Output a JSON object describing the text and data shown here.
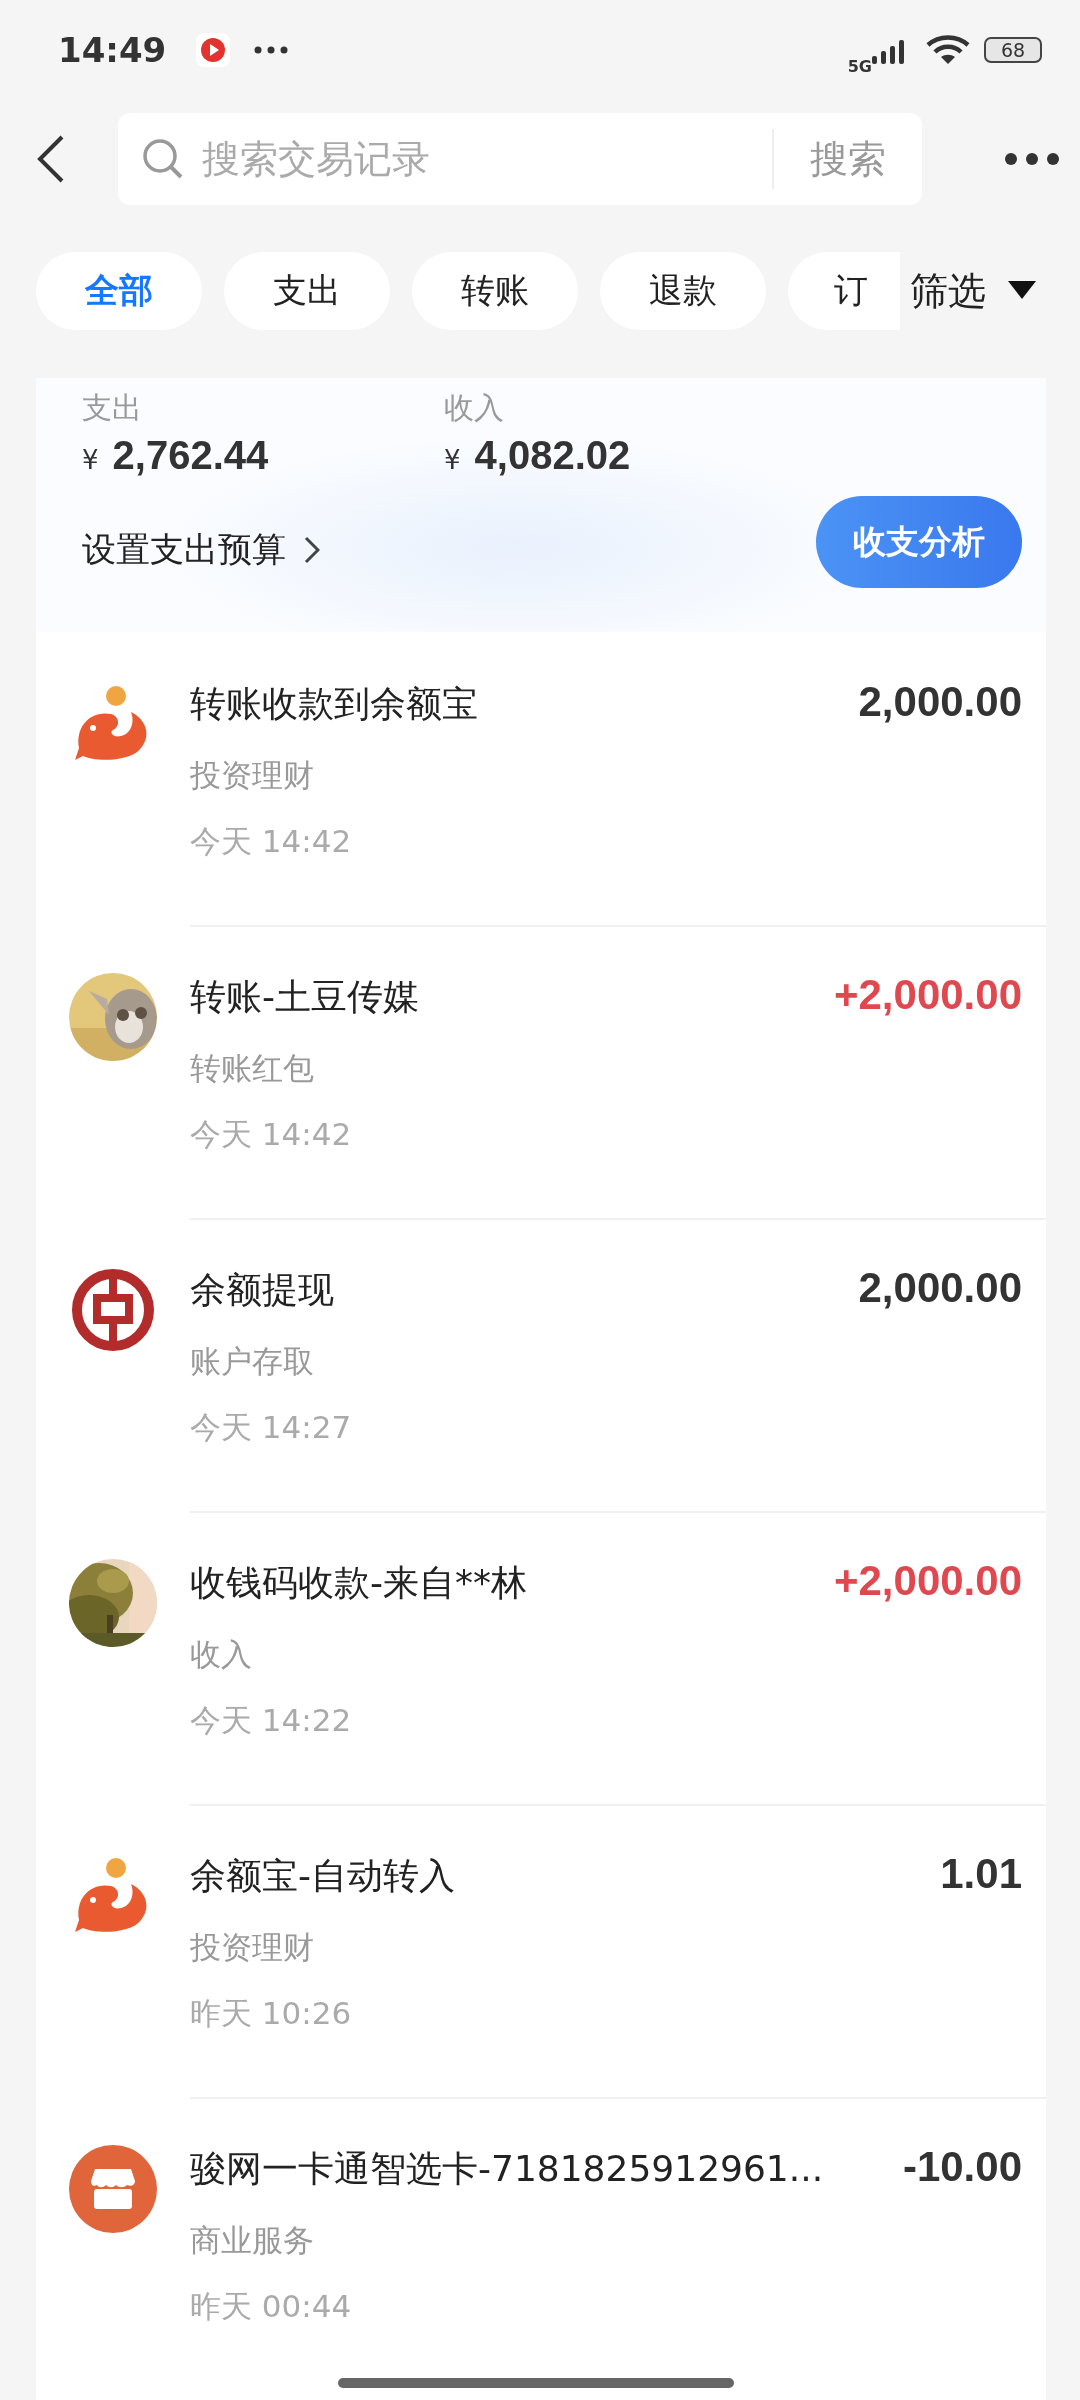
{
  "status_bar": {
    "time": "14:49",
    "network": "5G",
    "battery": "68"
  },
  "header": {
    "search": {
      "placeholder": "搜索交易记录"
    },
    "search_button": "搜索"
  },
  "tabs": [
    {
      "label": "全部",
      "selected": true
    },
    {
      "label": "支出",
      "selected": false
    },
    {
      "label": "转账",
      "selected": false
    },
    {
      "label": "退款",
      "selected": false
    },
    {
      "label": "订",
      "selected": false
    }
  ],
  "filter": "筛选",
  "summary": {
    "expense_label": "支出",
    "expense_currency": "¥",
    "expense": "2,762.44",
    "income_label": "收入",
    "income_currency": "¥",
    "income": "4,082.02",
    "budget_link": "设置支出预算",
    "analysis_button": "收支分析"
  },
  "transactions": [
    {
      "icon": {
        "kind": "whale"
      },
      "title": "转账收款到余额宝",
      "category": "投资理财",
      "time": "今天 14:42",
      "amount": "2,000.00",
      "income": false
    },
    {
      "title": "转账-土豆传媒",
      "category": "转账红包",
      "time": "今天 14:42",
      "amount": "+2,000.00",
      "income": true
    },
    {
      "icon": {
        "kind": "bank"
      },
      "title": "余额提现",
      "category": "账户存取",
      "time": "今天 14:27",
      "amount": "2,000.00",
      "income": false
    },
    {
      "title": "收钱码收款-来自**林",
      "category": "收入",
      "time": "今天 14:22",
      "amount": "+2,000.00",
      "income": true
    },
    {
      "icon": {
        "kind": "whale"
      },
      "title": "余额宝-自动转入",
      "category": "投资理财",
      "time": "昨天 10:26",
      "amount": "1.01",
      "income": false
    },
    {
      "icon": {
        "kind": "store"
      },
      "title": "骏网一卡通智选卡-7181825912961...",
      "category": "商业服务",
      "time": "昨天 00:44",
      "amount": "-10.00",
      "income": false
    }
  ]
}
